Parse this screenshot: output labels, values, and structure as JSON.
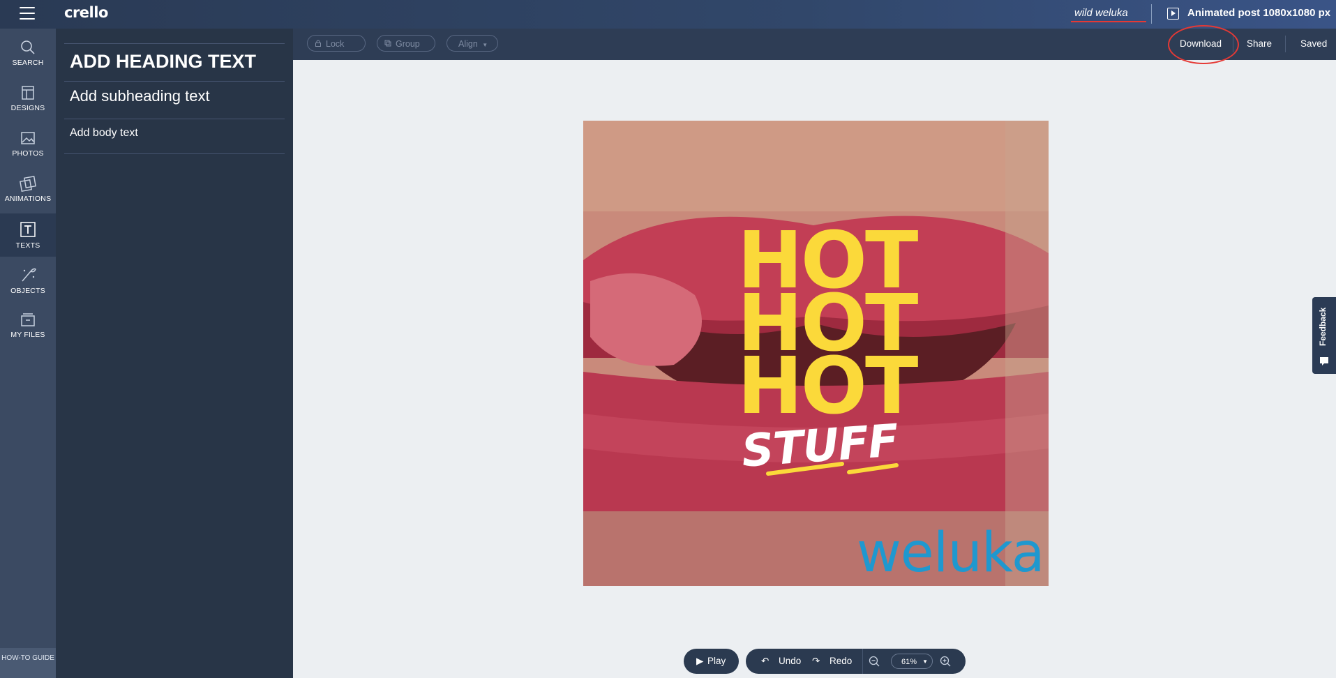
{
  "app": {
    "logo": "crello"
  },
  "header": {
    "document_name": "wild weluka",
    "format_label": "Animated post 1080x1080 px"
  },
  "nav": {
    "items": [
      {
        "label": "SEARCH",
        "icon": "search-icon"
      },
      {
        "label": "DESIGNS",
        "icon": "designs-icon"
      },
      {
        "label": "PHOTOS",
        "icon": "photo-icon"
      },
      {
        "label": "ANIMATIONS",
        "icon": "animations-icon"
      },
      {
        "label": "TEXTS",
        "icon": "text-icon",
        "active": true
      },
      {
        "label": "OBJECTS",
        "icon": "objects-icon"
      },
      {
        "label": "MY FILES",
        "icon": "folder-icon"
      }
    ],
    "how_to_guide": "HOW-TO GUIDE"
  },
  "panel": {
    "heading": "ADD HEADING TEXT",
    "subheading": "Add subheading text",
    "body": "Add body text"
  },
  "toolbar": {
    "lock": "Lock",
    "group": "Group",
    "align": "Align",
    "download": "Download",
    "share": "Share",
    "saved": "Saved"
  },
  "canvas": {
    "line1": "HOT",
    "line2": "HOT",
    "line3": "HOT",
    "stuff": "STUFF",
    "brand": "weluka"
  },
  "feedback": "Feedback",
  "bottom": {
    "play": "Play",
    "undo": "Undo",
    "redo": "Redo",
    "zoom": "61%"
  },
  "colors": {
    "accent_yellow": "#fbd93a",
    "brand_blue": "#1f98cf",
    "annotation_red": "#e53935",
    "nav_bg": "#3b4a62",
    "panel_bg": "#283547"
  }
}
